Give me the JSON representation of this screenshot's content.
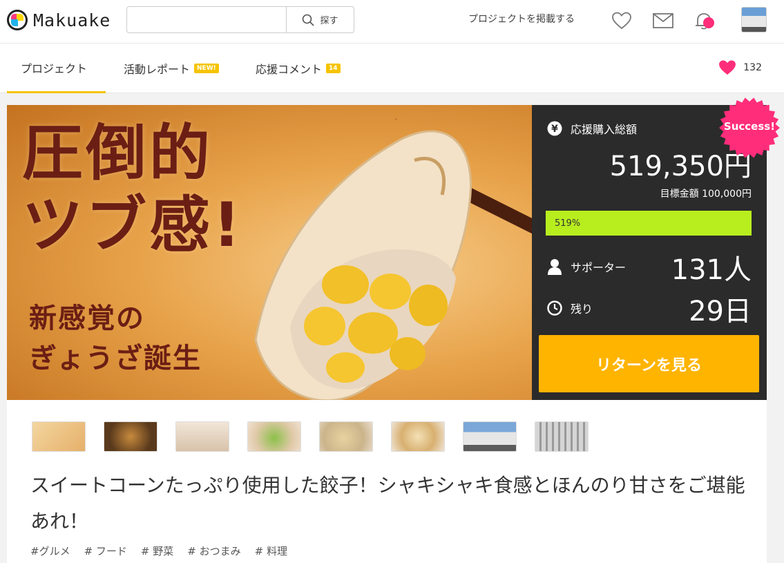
{
  "header": {
    "logo_text": "Makuake",
    "search_placeholder": "",
    "search_button": "探す",
    "nav_post_project": "プロジェクトを掲載する"
  },
  "tabs": [
    {
      "label": "プロジェクト",
      "badge": ""
    },
    {
      "label": "活動レポート",
      "badge": "NEW!"
    },
    {
      "label": "応援コメント",
      "badge": "14"
    }
  ],
  "favorites_count": "132",
  "hero": {
    "title": "圧倒的\nツブ感!",
    "subtitle": "新感覚の\nぎょうざ誕生"
  },
  "panel": {
    "total_label": "応援購入総額",
    "total_amount": "519,350円",
    "goal": "目標金額 100,000円",
    "progress_label": "519%",
    "progress_fraction": 1.0,
    "supporters_label": "サポーター",
    "supporters_value": "131人",
    "remaining_label": "残り",
    "remaining_value": "29日",
    "return_button": "リターンを見る",
    "success_badge": "Success!"
  },
  "thumbnails": [
    "thumb-1",
    "thumb-2",
    "thumb-3",
    "thumb-4",
    "thumb-5",
    "thumb-6",
    "thumb-7",
    "thumb-8"
  ],
  "project": {
    "title": "スイートコーンたっぷり使用した餃子！シャキシャキ食感とほんのり甘さをご堪能あれ！",
    "tags": [
      "#グルメ",
      "# フード",
      "# 野菜",
      "# おつまみ",
      "# 料理"
    ]
  },
  "colors": {
    "accent_yellow": "#f5c400",
    "return_orange": "#ffb400",
    "progress_green": "#b8ee1e",
    "pink": "#ff2d7a",
    "panel_dark": "#2b2b2b"
  }
}
